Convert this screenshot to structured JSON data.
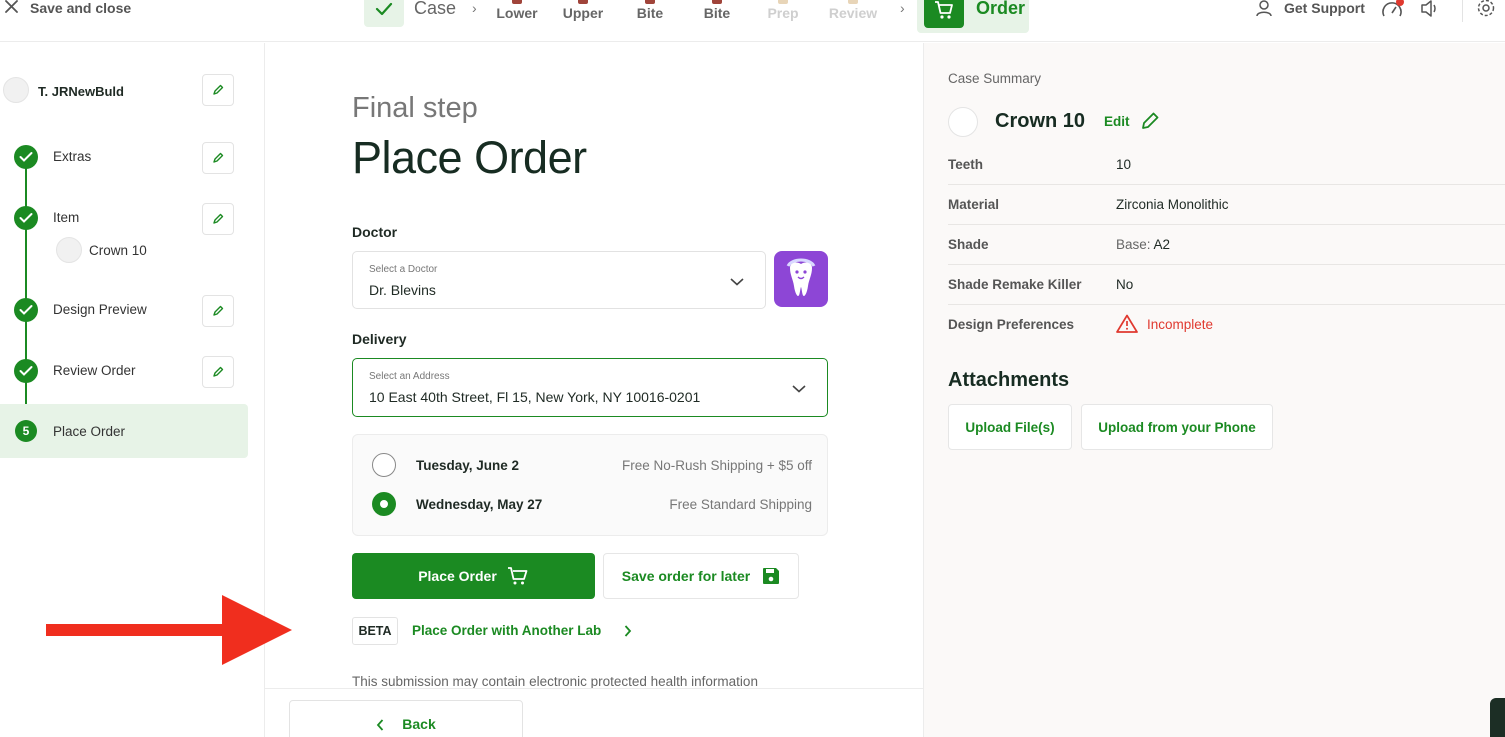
{
  "topbar": {
    "save_close": "Save and close",
    "steps": {
      "case": "Case",
      "lower": "Lower",
      "upper": "Upper",
      "bite1": "Bite",
      "bite2": "Bite",
      "prep": "Prep",
      "review": "Review",
      "order": "Order"
    },
    "get_support": "Get Support"
  },
  "sidebar": {
    "case_name": "T. JRNewBuld",
    "items": [
      {
        "label": "Extras",
        "status": "done"
      },
      {
        "label": "Item",
        "status": "done",
        "sub_item": "Crown 10"
      },
      {
        "label": "Design Preview",
        "status": "done"
      },
      {
        "label": "Review Order",
        "status": "done"
      },
      {
        "label": "Place Order",
        "status": "active",
        "number": "5"
      }
    ]
  },
  "main": {
    "pre_title": "Final step",
    "title": "Place Order",
    "doctor": {
      "label": "Doctor",
      "caption": "Select a Doctor",
      "value": "Dr. Blevins"
    },
    "delivery": {
      "label": "Delivery",
      "caption": "Select an Address",
      "value": "10 East 40th Street, Fl 15, New York, NY 10016-0201"
    },
    "shipping_options": [
      {
        "date": "Tuesday, June 2",
        "note": "Free No-Rush Shipping + $5 off",
        "selected": false
      },
      {
        "date": "Wednesday, May 27",
        "note": "Free Standard Shipping",
        "selected": true
      }
    ],
    "place_order_button": "Place Order",
    "save_later_button": "Save order for later",
    "beta_badge": "BETA",
    "another_lab_link": "Place Order with Another Lab",
    "disclaimer": "This submission may contain electronic protected health information",
    "back_button": "Back"
  },
  "summary": {
    "heading": "Case Summary",
    "item_title": "Crown 10",
    "edit_label": "Edit",
    "rows": [
      {
        "key": "Teeth",
        "value": "10"
      },
      {
        "key": "Material",
        "value": "Zirconia Monolithic"
      },
      {
        "key": "Shade",
        "prefix": "Base:",
        "value": "A2"
      },
      {
        "key": "Shade Remake Killer",
        "value": "No"
      },
      {
        "key": "Design Preferences",
        "value": "Incomplete",
        "status": "warning"
      }
    ],
    "attachments_title": "Attachments",
    "upload_files": "Upload File(s)",
    "upload_phone": "Upload from your Phone"
  },
  "colors": {
    "brand_green": "#1b8a22",
    "light_green": "#e7f3e7",
    "warning_red": "#e0392f",
    "doctor_icon_purple": "#8d46d6",
    "annotation_arrow": "#f02e1e"
  },
  "icons": [
    "close-icon",
    "check-icon",
    "chevron-right-icon",
    "cart-icon",
    "user-icon",
    "speedometer-icon",
    "speaker-icon",
    "gear-icon",
    "pencil-icon",
    "chevron-down-icon",
    "tooth-icon",
    "save-icon",
    "warning-icon",
    "chevron-left-icon"
  ]
}
